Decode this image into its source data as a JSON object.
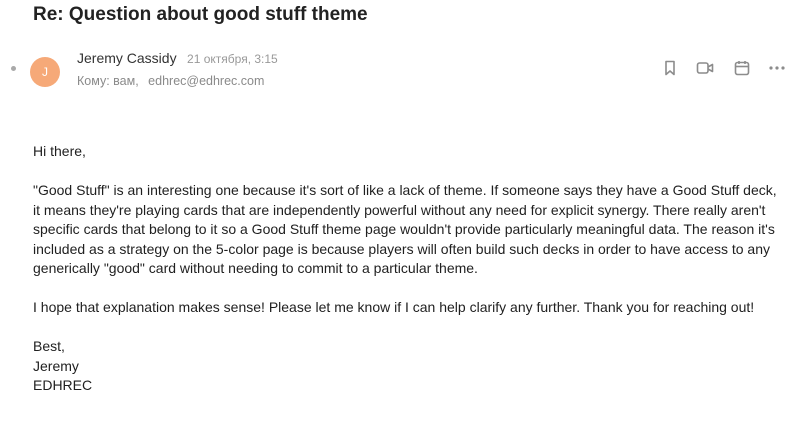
{
  "email": {
    "subject": "Re: Question about good stuff theme",
    "sender": {
      "initial": "J",
      "name": "Jeremy Cassidy",
      "date": "21 октября, 3:15",
      "avatar_color": "#f6a978"
    },
    "recipients": {
      "to_label": "Кому: вам,",
      "address": "edhrec@edhrec.com"
    },
    "actions": [
      {
        "name": "bookmark-icon"
      },
      {
        "name": "video-call-icon"
      },
      {
        "name": "calendar-icon"
      },
      {
        "name": "more-options-icon"
      }
    ],
    "body": {
      "greeting": "Hi there,",
      "paragraph_1": "\"Good Stuff\" is an interesting one because it's sort of like a lack of theme. If someone says they have a Good Stuff deck, it means they're playing cards that are independently powerful without any need for explicit synergy. There really aren't specific cards that belong to it so a Good Stuff theme page wouldn't provide particularly meaningful data. The reason it's included as a strategy on the 5-color page is because players will often build such decks in order to have access to any generically \"good\" card without needing to commit to a particular theme.",
      "paragraph_2": "I hope that explanation makes sense! Please let me know if I can help clarify any further. Thank you for reaching out!",
      "closing": "Best,",
      "signature_name": "Jeremy",
      "signature_org": "EDHREC"
    }
  }
}
